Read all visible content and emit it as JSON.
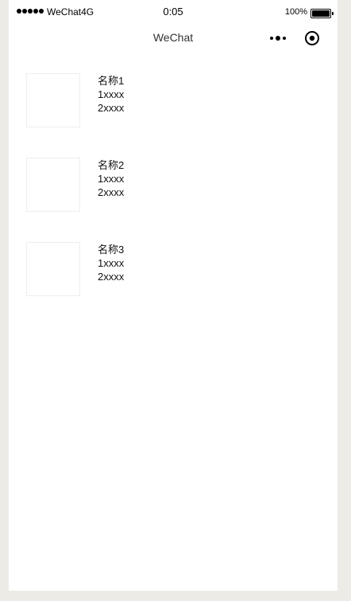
{
  "status_bar": {
    "carrier": "WeChat4G",
    "time": "0:05",
    "battery": "100%"
  },
  "nav": {
    "title": "WeChat",
    "more_icon": "more-dots-icon",
    "close_icon": "target-circle-icon"
  },
  "items": [
    {
      "name": "名称1",
      "line1": "1xxxx",
      "line2": "2xxxx"
    },
    {
      "name": "名称2",
      "line1": "1xxxx",
      "line2": "2xxxx"
    },
    {
      "name": "名称3",
      "line1": "1xxxx",
      "line2": "2xxxx"
    }
  ],
  "colors": {
    "page_bg": "#ecebe6",
    "screen_bg": "#ffffff",
    "thumb_border": "#eeeeee",
    "text": "#111111"
  }
}
